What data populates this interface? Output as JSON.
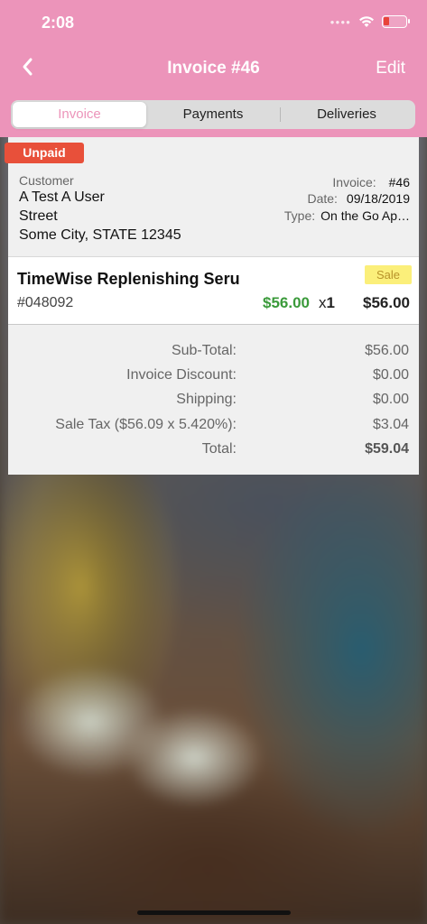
{
  "status_bar": {
    "time": "2:08",
    "icons": [
      "signal-dots-icon",
      "wifi-icon",
      "battery-low-charging-icon"
    ]
  },
  "nav": {
    "back_icon": "chevron-left-icon",
    "title": "Invoice #46",
    "edit_label": "Edit"
  },
  "tabs": [
    {
      "label": "Invoice",
      "active": true
    },
    {
      "label": "Payments",
      "active": false
    },
    {
      "label": "Deliveries",
      "active": false
    }
  ],
  "invoice": {
    "status_badge": "Unpaid",
    "customer_label": "Customer",
    "customer_name": "A Test A User",
    "customer_street": "Street",
    "customer_city": "Some City, STATE 12345",
    "invoice_key": "Invoice:",
    "invoice_value": "#46",
    "date_key": "Date:",
    "date_value": "09/18/2019",
    "type_key": "Type:",
    "type_value": "On the Go Ap…"
  },
  "line_items": [
    {
      "name": "TimeWise Replenishing Seru",
      "sku": "#048092",
      "badge": "Sale",
      "price": "$56.00",
      "qty": "1",
      "total": "$56.00"
    }
  ],
  "totals": {
    "subtotal_label": "Sub-Total:",
    "subtotal_value": "$56.00",
    "discount_label": "Invoice Discount:",
    "discount_value": "$0.00",
    "shipping_label": "Shipping:",
    "shipping_value": "$0.00",
    "tax_label": "Sale Tax ($56.09 x 5.420%):",
    "tax_value": "$3.04",
    "total_label": "Total:",
    "total_value": "$59.04"
  },
  "colors": {
    "header_pink": "#ec94ba",
    "unpaid_red": "#e8503a",
    "price_green": "#3a9a3a",
    "sale_yellow": "#fbef7a"
  }
}
